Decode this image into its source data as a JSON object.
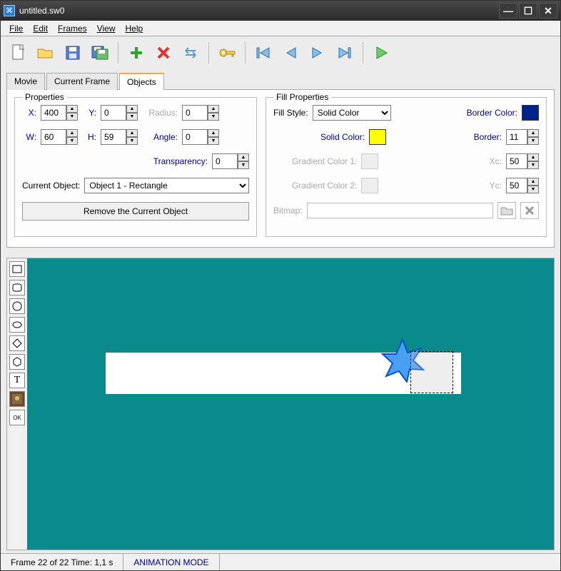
{
  "titlebar": {
    "title": "untitled.sw0"
  },
  "menu": {
    "file": "File",
    "edit": "Edit",
    "frames": "Frames",
    "view": "View",
    "help": "Help"
  },
  "tabs": {
    "movie": "Movie",
    "current_frame": "Current Frame",
    "objects": "Objects"
  },
  "props": {
    "legend": "Properties",
    "x_label": "X:",
    "x": "400",
    "y_label": "Y:",
    "y": "0",
    "radius_label": "Radius:",
    "radius": "0",
    "w_label": "W:",
    "w": "60",
    "h_label": "H:",
    "h": "59",
    "angle_label": "Angle:",
    "angle": "0",
    "transparency_label": "Transparency:",
    "transparency": "0",
    "current_object_label": "Current Object:",
    "current_object": "Object 1 - Rectangle",
    "remove_btn": "Remove the Current Object"
  },
  "fill": {
    "legend": "Fill Properties",
    "style_label": "Fill Style:",
    "style": "Solid Color",
    "border_color_label": "Border Color:",
    "border_color": "#002288",
    "solid_color_label": "Solid Color:",
    "solid_color": "#ffff00",
    "border_label": "Border:",
    "border": "11",
    "grad1_label": "Gradient Color 1:",
    "xc_label": "Xc:",
    "xc": "50",
    "grad2_label": "Gradient Color 2:",
    "yc_label": "Yc:",
    "yc": "50",
    "bitmap_label": "Bitmap:"
  },
  "shape_tools": {
    "ok": "OK",
    "t": "T"
  },
  "status": {
    "frame": "Frame 22 of 22 Time: 1,1 s",
    "mode": "ANIMATION MODE"
  }
}
